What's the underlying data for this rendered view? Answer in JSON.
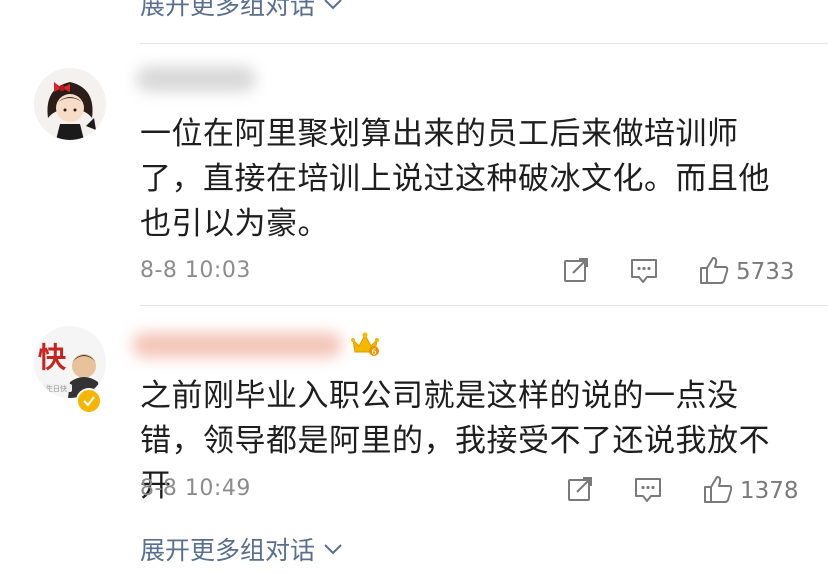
{
  "expand_replies_label": "展开更多组对话",
  "comments": [
    {
      "text": "一位在阿里聚划算出来的员工后来做培训师了，直接在培训上说过这种破冰文化。而且他也引以为豪。",
      "time": "8-8 10:03",
      "likes": "5733"
    },
    {
      "avatar_text": "快",
      "text": "之前刚毕业入职公司就是这样的说的一点没错，领导都是阿里的，我接受不了还说我放不开",
      "time": "8-8 10:49",
      "likes": "1378"
    }
  ],
  "icons": [
    "chevron-down-icon",
    "share-icon",
    "reply-icon",
    "like-icon",
    "crown-badge-icon",
    "verified-badge-icon"
  ],
  "colors": {
    "link": "#5a6f8f",
    "meta": "#8c8c8c",
    "text": "#1e1e1e",
    "divider": "#e6e6e6",
    "crown": "#f5b800"
  }
}
